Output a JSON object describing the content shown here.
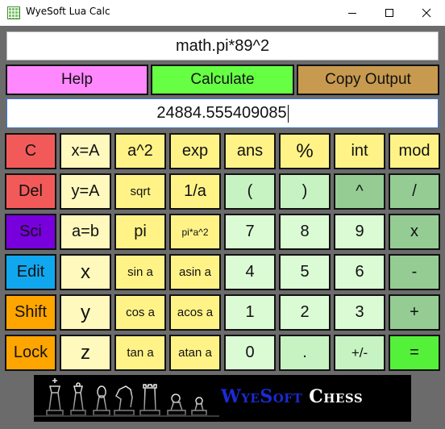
{
  "window": {
    "title": "WyeSoft Lua Calc",
    "icons": {
      "app": "calculator-grid-icon",
      "minimize": "minimize-icon",
      "maximize": "maximize-icon",
      "close": "close-icon"
    }
  },
  "input": {
    "expression": "math.pi*89^2"
  },
  "actions": {
    "help": "Help",
    "calculate": "Calculate",
    "copy_output": "Copy Output"
  },
  "output": {
    "value": "24884.555409085"
  },
  "colors": {
    "help": "#ff88ff",
    "calculate": "#66ff44",
    "copy_output": "#c79a4f",
    "c": "#f25a5a",
    "del": "#f25a5a",
    "sci": "#7700dd",
    "edit": "#11a7ee",
    "shift": "#ffa500",
    "lock": "#ffa500",
    "equals": "#55f03a",
    "pale_yellow": "#fff9bd",
    "yellow": "#fff387",
    "light_green": "#c7f2c2",
    "mid_green": "#94cc94",
    "pale_green": "#dbfbd5"
  },
  "keys": {
    "row1": [
      "C",
      "x=A",
      "a^2",
      "exp",
      "ans",
      "%",
      "int",
      "mod"
    ],
    "row2": [
      "Del",
      "y=A",
      "sqrt",
      "1/a",
      "(",
      ")",
      "^",
      "/"
    ],
    "row3": [
      "Sci",
      "a=b",
      "pi",
      "pi*a^2",
      "7",
      "8",
      "9",
      "x"
    ],
    "row4": [
      "Edit",
      "x",
      "sin a",
      "asin a",
      "4",
      "5",
      "6",
      "-"
    ],
    "row5": [
      "Shift",
      "y",
      "cos a",
      "acos a",
      "1",
      "2",
      "3",
      "+"
    ],
    "row6": [
      "Lock",
      "z",
      "tan a",
      "atan a",
      "0",
      ".",
      "+/-",
      "="
    ]
  },
  "banner": {
    "brand_word1": "WyeSoft",
    "brand_word2": "Chess",
    "image": "chess-pieces-image"
  }
}
